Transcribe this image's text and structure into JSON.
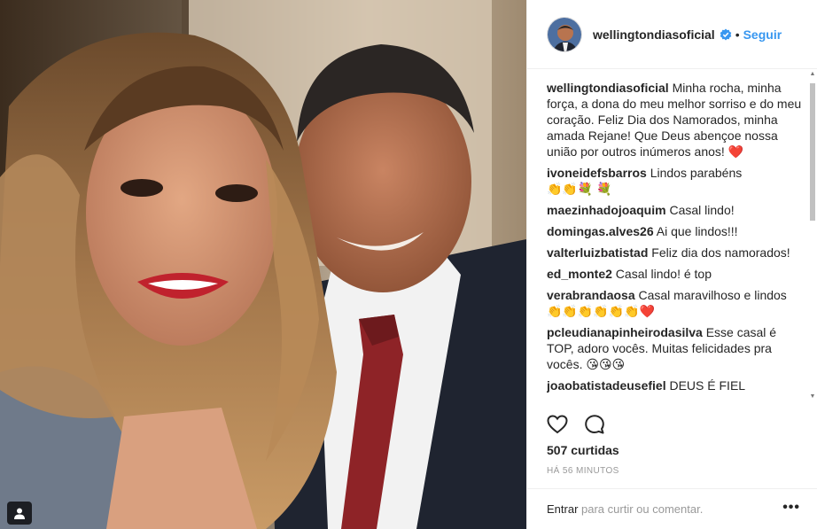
{
  "post": {
    "username": "wellingtondiasoficial",
    "follow_label": "Seguir",
    "dot": "•",
    "likes": "507 curtidas",
    "timestamp": "HÁ 56 MINUTOS",
    "signin_link": "Entrar",
    "signin_rest": " para curtir ou comentar.",
    "more_label": "•••"
  },
  "comments": [
    {
      "user": "wellingtondiasoficial",
      "text": " Minha rocha, minha força, a dona do meu melhor sorriso e do meu coração. Feliz Dia dos Namorados, minha amada Rejane! Que Deus abençoe nossa união por outros inúmeros anos! ",
      "emoji": "❤️"
    },
    {
      "user": "ivoneidefsbarros",
      "text": " Lindos parabéns ",
      "emoji": "👏👏💐 💐"
    },
    {
      "user": "maezinhadojoaquim",
      "text": " Casal lindo!",
      "emoji": ""
    },
    {
      "user": "domingas.alves26",
      "text": " Ai que lindos!!!",
      "emoji": ""
    },
    {
      "user": "valterluizbatistad",
      "text": " Feliz dia dos namorados!",
      "emoji": ""
    },
    {
      "user": "ed_monte2",
      "text": " Casal lindo! é top",
      "emoji": ""
    },
    {
      "user": "verabrandaosa",
      "text": " Casal maravilhoso e lindos ",
      "emoji": "👏👏👏👏👏👏❤️"
    },
    {
      "user": "pcleudianapinheirodasilva",
      "text": " Esse casal é TOP, adoro vocês. Muitas felicidades pra vocês. ",
      "emoji": "😘😘😘"
    },
    {
      "user": "joaobatistadeusefiel",
      "text": " DEUS É FIEL",
      "emoji": ""
    }
  ],
  "colors": {
    "link_blue": "#3897f0",
    "text": "#262626",
    "muted": "#999999",
    "verified_blue": "#3897f0"
  },
  "icons": {
    "like": "heart-outline-icon",
    "comment": "speech-bubble-icon",
    "verified": "verified-badge-icon",
    "tag": "person-tag-icon"
  }
}
